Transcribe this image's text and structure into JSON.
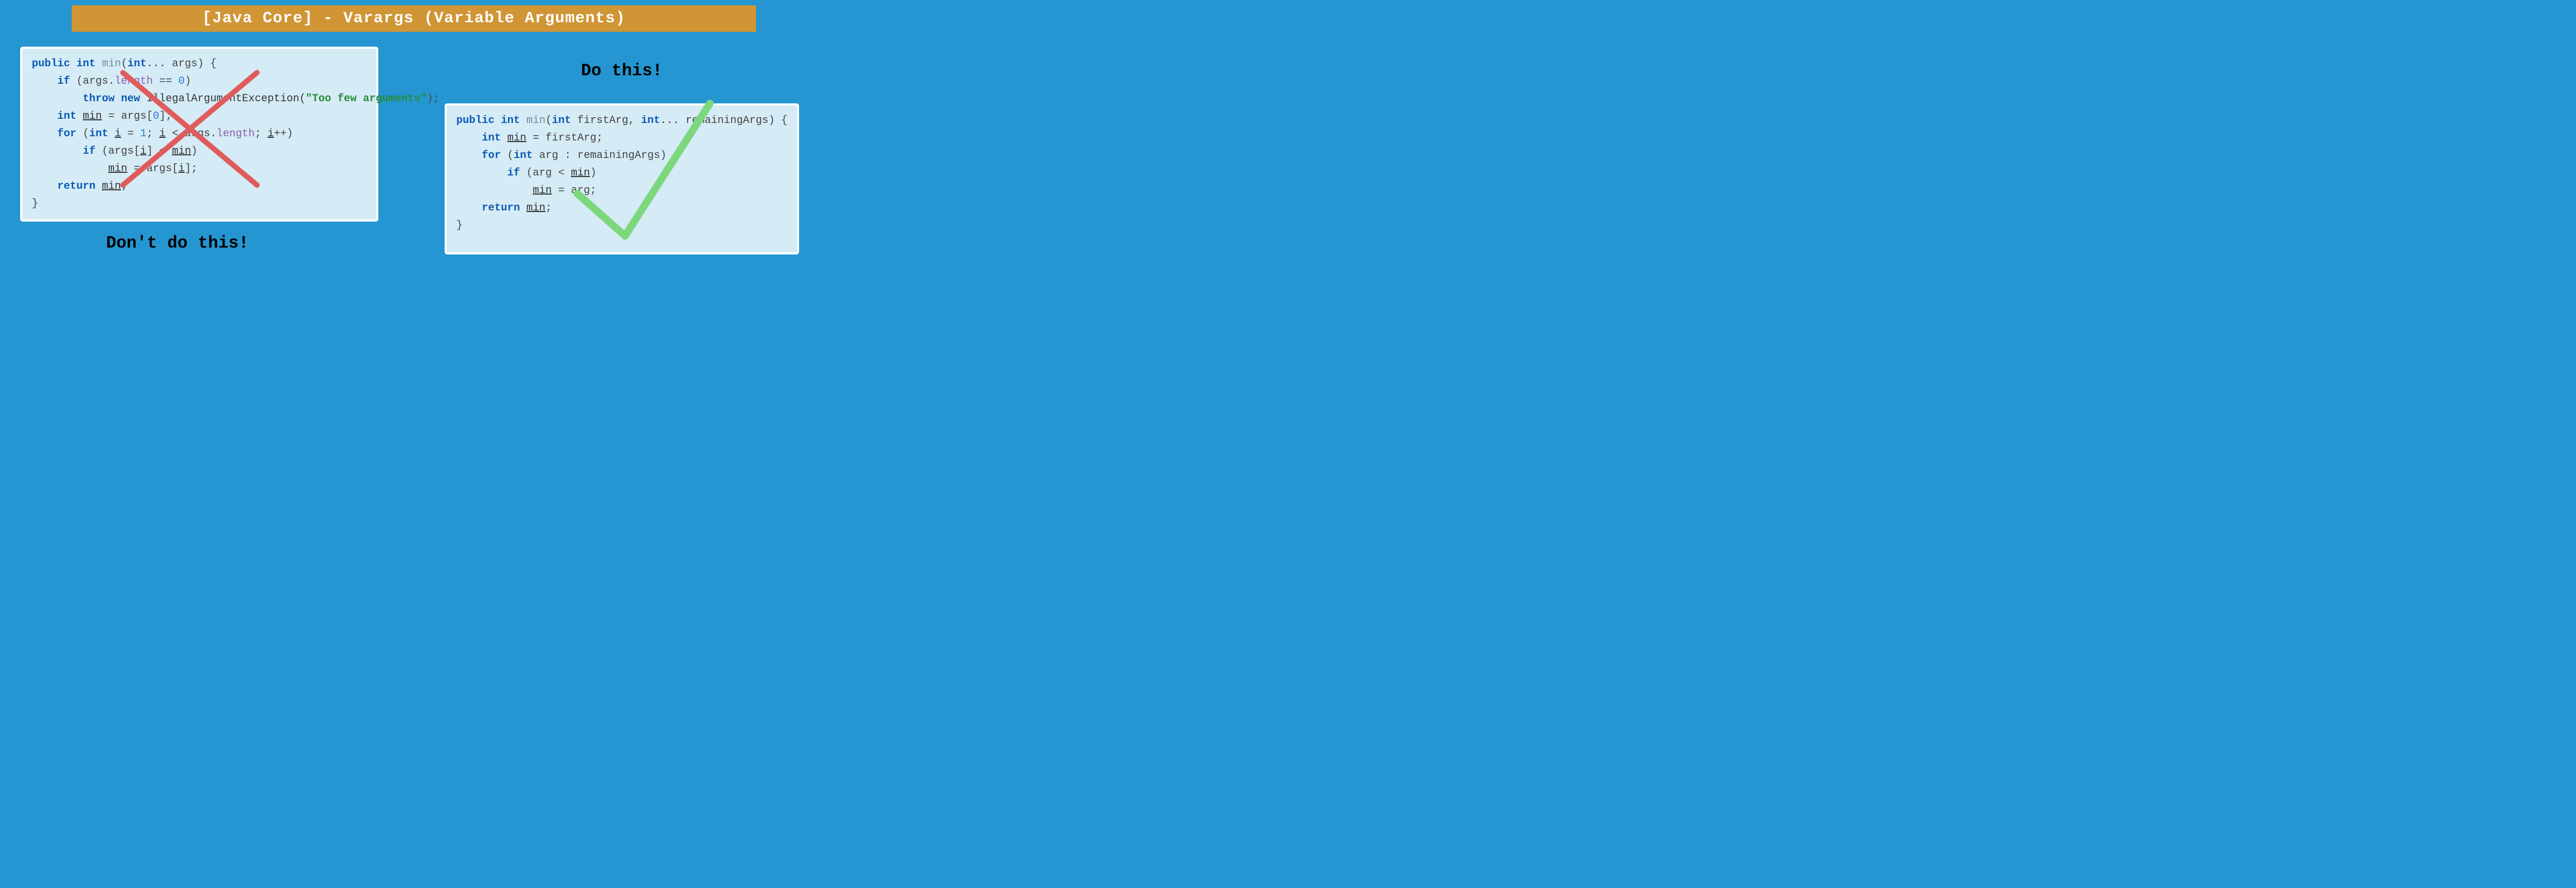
{
  "title": "[Java Core] - Varargs (Variable Arguments)",
  "left": {
    "caption": "Don't do this!",
    "code": {
      "l1": {
        "kw1": "public",
        "type1": "int",
        "method": "min",
        "type2": "int",
        "dots": "...",
        "param": " args",
        "brace": ") {"
      },
      "l2": {
        "kw": "if",
        "open": " (args.",
        "prop": "length",
        "rest": " == ",
        "num": "0",
        "close": ")"
      },
      "l3": {
        "kw1": "throw",
        "kw2": "new",
        "cls": " IllegalArgumentException(",
        "str": "\"Too few arguments\"",
        "end": ");"
      },
      "l4": {
        "type": "int",
        "var": "min",
        "eq": " = args[",
        "num": "0",
        "end": "];"
      },
      "l5": {
        "kw": "for",
        "open": " (",
        "type": "int",
        "var1": "i",
        "eq": " = ",
        "num1": "1",
        "semi": "; ",
        "var2": "i",
        "lt": " < args.",
        "prop": "length",
        "semi2": "; ",
        "var3": "i",
        "inc": "++)"
      },
      "l6": {
        "kw": "if",
        "open": " (args[",
        "var1": "i",
        "mid": "] < ",
        "var2": "min",
        "close": ")"
      },
      "l7": {
        "var": "min",
        "eq": " = args[",
        "var2": "i",
        "end": "];"
      },
      "l8": {
        "kw": "return",
        "sp": " ",
        "var": "min",
        "end": ";"
      },
      "l9": "}"
    }
  },
  "right": {
    "caption": "Do this!",
    "code": {
      "l1": {
        "kw1": "public",
        "type1": "int",
        "method": "min",
        "type2": "int",
        "p1": " firstArg, ",
        "type3": "int",
        "dots": "...",
        "p2": " remainingArgs",
        "brace": ") {"
      },
      "l2": {
        "type": "int",
        "var": "min",
        "eq": " = firstArg;"
      },
      "l3": {
        "kw": "for",
        "open": " (",
        "type": "int",
        "p": " arg : remainingArgs)"
      },
      "l4": {
        "kw": "if",
        "open": " (arg < ",
        "var": "min",
        "close": ")"
      },
      "l5": {
        "var": "min",
        "eq": " = arg;"
      },
      "l6": {
        "kw": "return",
        "sp": " ",
        "var": "min",
        "end": ";"
      },
      "l7": "}"
    }
  }
}
